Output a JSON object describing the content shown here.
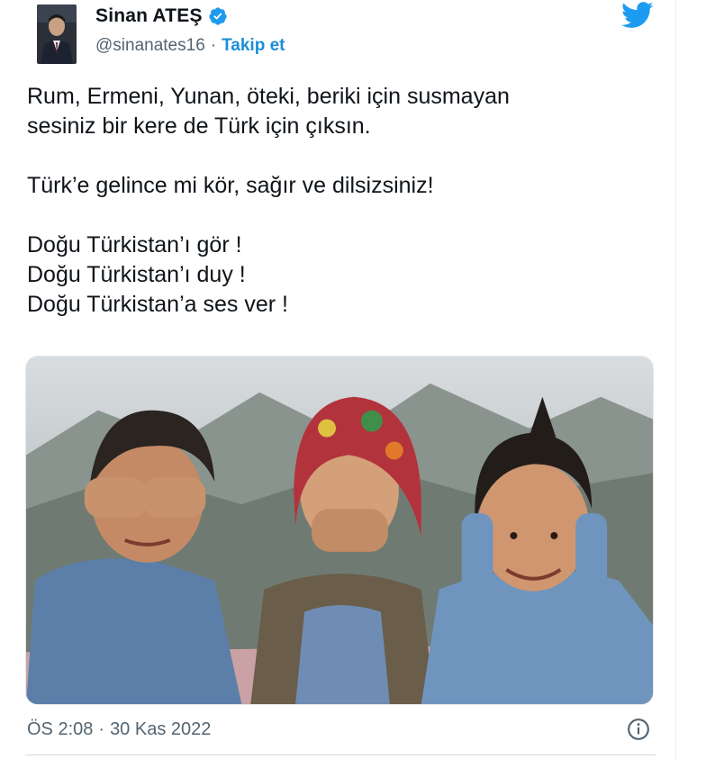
{
  "author": {
    "display_name": "Sinan ATEŞ",
    "handle": "@sinanates16",
    "separator": "·",
    "follow_label": "Takip et",
    "verified": true
  },
  "tweet": {
    "lines": [
      "Rum, Ermeni, Yunan, öteki, beriki için susmayan",
      "sesiniz bir kere de Türk için çıksın.",
      "",
      "Türk’e gelince mi kör, sağır ve dilsizsiniz!",
      "",
      "Doğu Türkistan’ı gör !",
      "Doğu Türkistan’ı duy !",
      "Doğu Türkistan’a ses ver !"
    ]
  },
  "media": {
    "description_icon": "photo-three-children-icon"
  },
  "meta": {
    "time": "ÖS 2:08",
    "separator": "·",
    "date": "30 Kas 2022"
  },
  "colors": {
    "accent": "#1d9bf0",
    "text": "#0f1419",
    "secondary": "#536471"
  },
  "icons": [
    "verified-badge-icon",
    "twitter-bird-icon",
    "info-icon"
  ]
}
